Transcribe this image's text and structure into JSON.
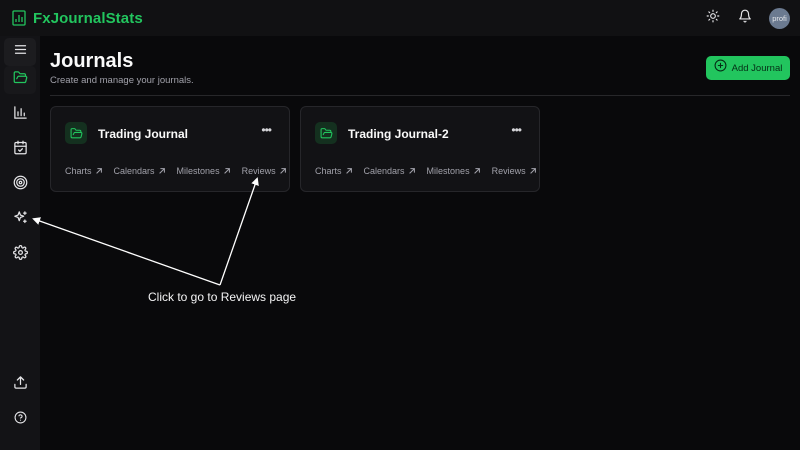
{
  "app": {
    "name": "FxJournalStats",
    "brand_color": "#22c55e"
  },
  "header": {
    "theme_icon": "sun-icon",
    "notifications_icon": "bell-icon",
    "avatar_text": "profi"
  },
  "sidebar": {
    "items": [
      {
        "name": "menu",
        "icon": "menu-icon"
      },
      {
        "name": "journals",
        "icon": "folder-open-icon",
        "active": true
      },
      {
        "name": "charts",
        "icon": "bar-chart-icon"
      },
      {
        "name": "calendars",
        "icon": "calendar-check-icon"
      },
      {
        "name": "milestones",
        "icon": "target-icon"
      },
      {
        "name": "reviews",
        "icon": "sparkles-icon"
      },
      {
        "name": "settings",
        "icon": "gear-icon"
      }
    ],
    "bottom_items": [
      {
        "name": "upload",
        "icon": "upload-icon"
      },
      {
        "name": "help",
        "icon": "help-circle-icon"
      }
    ]
  },
  "main": {
    "title": "Journals",
    "subtitle": "Create and manage your journals.",
    "add_button_label": "Add Journal",
    "journals": [
      {
        "title": "Trading Journal",
        "links": [
          "Charts",
          "Calendars",
          "Milestones",
          "Reviews"
        ]
      },
      {
        "title": "Trading Journal-2",
        "links": [
          "Charts",
          "Calendars",
          "Milestones",
          "Reviews"
        ]
      }
    ]
  },
  "annotation": {
    "text": "Click to go to Reviews page"
  }
}
